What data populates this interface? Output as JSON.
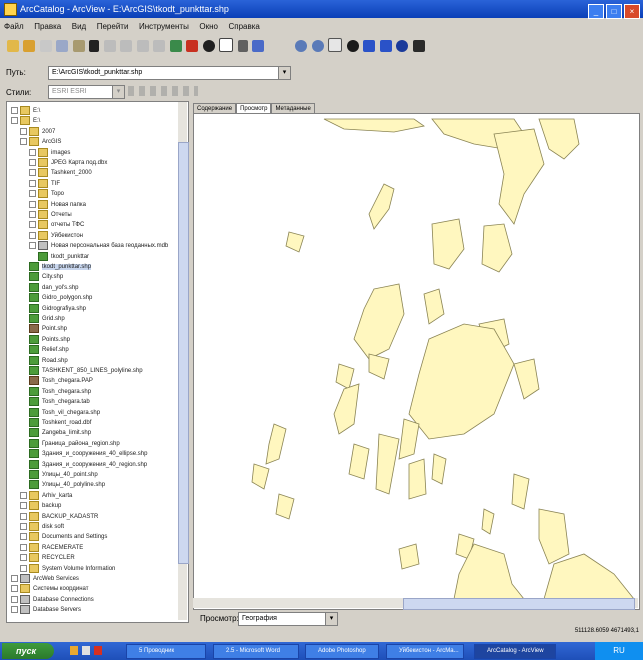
{
  "window": {
    "title": "ArcCatalog - ArcView - E:\\ArcGIS\\tkodt_punkttar.shp"
  },
  "menu": [
    "Файл",
    "Правка",
    "Вид",
    "Перейти",
    "Инструменты",
    "Окно",
    "Справка"
  ],
  "path": {
    "label": "Путь:",
    "value": "E:\\ArcGIS\\tkodt_punkttar.shp"
  },
  "styles": {
    "label": "Стили:",
    "value": "ESRI ESRI"
  },
  "tabs": [
    "Содержание",
    "Просмотр",
    "Метаданные"
  ],
  "active_tab": 1,
  "tree": [
    {
      "level": 0,
      "icon": "folder",
      "text": "E:\\"
    },
    {
      "level": 0,
      "icon": "folder",
      "text": "E:\\"
    },
    {
      "level": 1,
      "icon": "folder",
      "text": "2007"
    },
    {
      "level": 1,
      "icon": "folder",
      "text": "ArcGIS"
    },
    {
      "level": 2,
      "icon": "folder",
      "text": "images"
    },
    {
      "level": 2,
      "icon": "folder",
      "text": "JPEG Карта под.dbx"
    },
    {
      "level": 2,
      "icon": "folder",
      "text": "Tashkent_2000"
    },
    {
      "level": 2,
      "icon": "folder",
      "text": "TIF"
    },
    {
      "level": 2,
      "icon": "folder",
      "text": "Topo"
    },
    {
      "level": 2,
      "icon": "folder",
      "text": "Новая папка"
    },
    {
      "level": 2,
      "icon": "folder",
      "text": "Отчеты"
    },
    {
      "level": 2,
      "icon": "folder",
      "text": "отчеты ТФС"
    },
    {
      "level": 2,
      "icon": "folder",
      "text": "Уйбекистон"
    },
    {
      "level": 2,
      "icon": "database",
      "text": "Новая персональная база геоданных.mdb"
    },
    {
      "level": 3,
      "icon": "shape",
      "text": "tkodt_punkttar"
    },
    {
      "level": 2,
      "icon": "shape",
      "text": "tkodt_punkttar.shp"
    },
    {
      "level": 2,
      "icon": "shape",
      "text": "City.shp"
    },
    {
      "level": 2,
      "icon": "shape",
      "text": "dan_yol's.shp"
    },
    {
      "level": 2,
      "icon": "shape",
      "text": "Gidro_polygon.shp"
    },
    {
      "level": 2,
      "icon": "shape",
      "text": "Gidrografiya.shp"
    },
    {
      "level": 2,
      "icon": "shape",
      "text": "Grid.shp"
    },
    {
      "level": 2,
      "icon": "grid",
      "text": "Point.shp"
    },
    {
      "level": 2,
      "icon": "shape",
      "text": "Points.shp"
    },
    {
      "level": 2,
      "icon": "shape",
      "text": "Relief.shp"
    },
    {
      "level": 2,
      "icon": "shape",
      "text": "Road.shp"
    },
    {
      "level": 2,
      "icon": "shape",
      "text": "TASHKENT_850_LINES_polyline.shp"
    },
    {
      "level": 2,
      "icon": "grid",
      "text": "Tosh_chegara.PAP"
    },
    {
      "level": 2,
      "icon": "shape",
      "text": "Tosh_chegara.shp"
    },
    {
      "level": 2,
      "icon": "shape",
      "text": "Tosh_chegara.tab"
    },
    {
      "level": 2,
      "icon": "shape",
      "text": "Tosh_vil_chegara.shp"
    },
    {
      "level": 2,
      "icon": "shape",
      "text": "Toshkent_road.dbf"
    },
    {
      "level": 2,
      "icon": "shape",
      "text": "Zangeba_limit.shp"
    },
    {
      "level": 2,
      "icon": "shape",
      "text": "Граница_района_region.shp"
    },
    {
      "level": 2,
      "icon": "shape",
      "text": "Здания_и_сооружения_40_ellipse.shp"
    },
    {
      "level": 2,
      "icon": "shape",
      "text": "Здания_и_сооружения_40_region.shp"
    },
    {
      "level": 2,
      "icon": "shape",
      "text": "Улицы_40_point.shp"
    },
    {
      "level": 2,
      "icon": "shape",
      "text": "Улицы_40_polyline.shp"
    },
    {
      "level": 1,
      "icon": "folder",
      "text": "Arhiv_karta"
    },
    {
      "level": 1,
      "icon": "folder",
      "text": "backup"
    },
    {
      "level": 1,
      "icon": "folder",
      "text": "BACKUP_KADASTR"
    },
    {
      "level": 1,
      "icon": "folder",
      "text": "disk soft"
    },
    {
      "level": 1,
      "icon": "folder",
      "text": "Documents and Settings"
    },
    {
      "level": 1,
      "icon": "folder",
      "text": "RACEMERATE"
    },
    {
      "level": 1,
      "icon": "folder",
      "text": "RECYCLER"
    },
    {
      "level": 1,
      "icon": "folder",
      "text": "System Volume Information"
    },
    {
      "level": 0,
      "icon": "database",
      "text": "ArcWeb Services"
    },
    {
      "level": 0,
      "icon": "folder",
      "text": "Системы координат"
    },
    {
      "level": 0,
      "icon": "database",
      "text": "Database Connections"
    },
    {
      "level": 0,
      "icon": "database",
      "text": "Database Servers"
    }
  ],
  "preview": {
    "label": "Просмотр:",
    "mode": "География",
    "fill": "#fff7bf",
    "stroke": "#8a8454"
  },
  "status": {
    "text": "511128.6059  4671493,1"
  },
  "taskbar": {
    "start": "пуск",
    "items": [
      "5 Проводник",
      "2.5 - Microsoft Word",
      "Adobe Photoshop",
      "Уйбекистон - ArcMa...",
      "ArcCatalog - ArcView"
    ],
    "active": 4,
    "clock": "RU"
  },
  "colors": {
    "title": "#0a3fb7",
    "taskbar": "#1e4fb8",
    "polygon_fill": "#fff7bf"
  }
}
